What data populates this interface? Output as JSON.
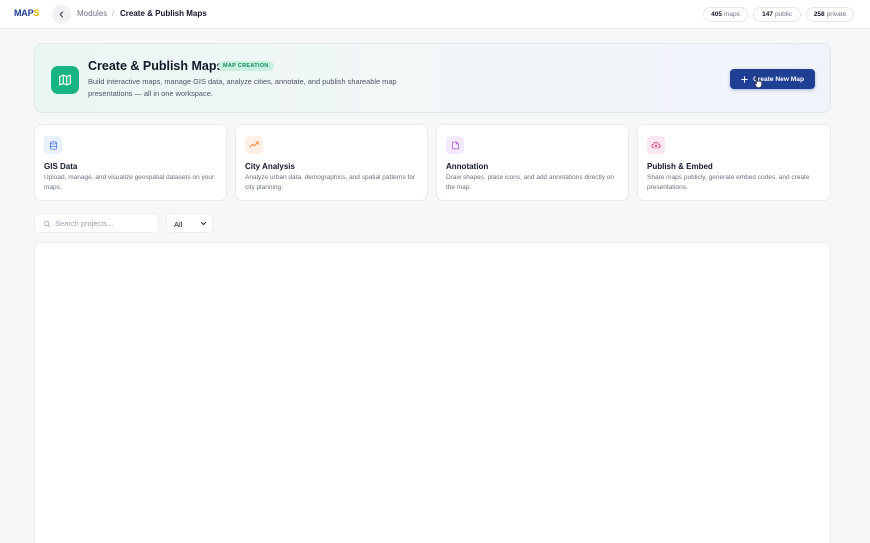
{
  "header": {
    "logo_main": "MAP",
    "logo_accent": "S",
    "breadcrumb": [
      "Modules",
      "Create & Publish Maps"
    ],
    "breadcrumb_separator": "/",
    "stats": [
      {
        "value": "405",
        "label": "maps"
      },
      {
        "value": "147",
        "label": "public"
      },
      {
        "value": "258",
        "label": "private"
      }
    ]
  },
  "hero": {
    "title": "Create & Publish Maps",
    "badge": "MAP CREATION",
    "description": "Build interactive maps, manage GIS data, analyze cities, annotate, and publish shareable map presentations — all in one workspace.",
    "cta_label": "Create New Map",
    "accent_color": "#18b383",
    "cta_color": "#1e3f94"
  },
  "features": [
    {
      "icon": "database-icon",
      "title": "GIS Data",
      "description": "Upload, manage, and visualize geospatial datasets on your maps.",
      "icon_bg": "#e8efff",
      "icon_color": "#3b6fd8"
    },
    {
      "icon": "trend-line-icon",
      "title": "City Analysis",
      "description": "Analyze urban data, demographics, and spatial patterns for city planning.",
      "icon_bg": "#fff0e6",
      "icon_color": "#ea7a2b"
    },
    {
      "icon": "note-icon",
      "title": "Annotation",
      "description": "Draw shapes, place icons, and add annotations directly on the map.",
      "icon_bg": "#f5eafd",
      "icon_color": "#a855d6"
    },
    {
      "icon": "cloud-upload-icon",
      "title": "Publish & Embed",
      "description": "Share maps publicly, generate embed codes, and create presentations.",
      "icon_bg": "#fde8f1",
      "icon_color": "#db3f86"
    }
  ],
  "toolbar": {
    "search_placeholder": "Search projects...",
    "filter_value": "All"
  }
}
